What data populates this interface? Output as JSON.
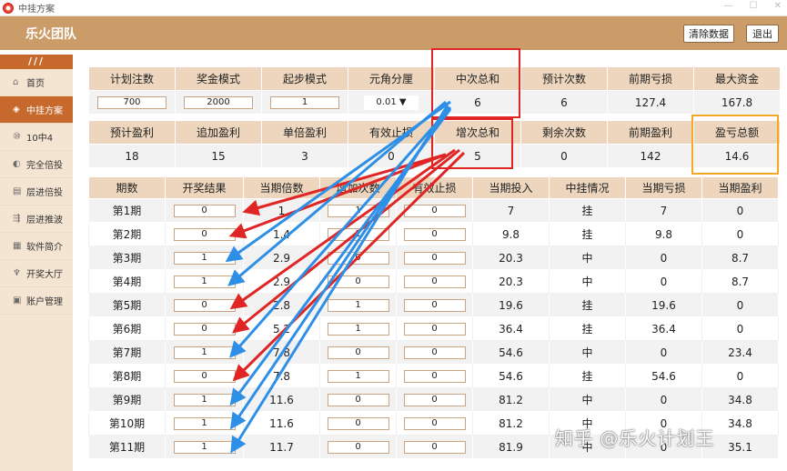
{
  "window": {
    "title": "中挂方案"
  },
  "header": {
    "brand": "乐火团队",
    "clear_label": "清除数据",
    "exit_label": "退出"
  },
  "sidebar": {
    "top": "///",
    "items": [
      {
        "icon": "home-icon",
        "label": "首页"
      },
      {
        "icon": "plan-icon",
        "label": "中挂方案"
      },
      {
        "icon": "ten-icon",
        "label": "10中4"
      },
      {
        "icon": "double-icon",
        "label": "完全倍投"
      },
      {
        "icon": "layer-icon",
        "label": "层进倍投"
      },
      {
        "icon": "push-icon",
        "label": "层进推波"
      },
      {
        "icon": "software-icon",
        "label": "软件简介"
      },
      {
        "icon": "draw-icon",
        "label": "开奖大厅"
      },
      {
        "icon": "account-icon",
        "label": "账户管理"
      }
    ],
    "active_index": 1
  },
  "settings": {
    "row1_headers": [
      "计划注数",
      "奖金模式",
      "起步模式",
      "元角分厘",
      "中次总和",
      "预计次数",
      "前期亏损",
      "最大资金"
    ],
    "row1_values": {
      "plan_bets": "700",
      "bonus_mode": "2000",
      "start_mode": "1",
      "unit": "0.01 ▼",
      "hit_total": "6",
      "expected_times": "6",
      "prior_loss": "127.4",
      "max_funds": "167.8"
    },
    "row2_headers": [
      "预计盈利",
      "追加盈利",
      "单倍盈利",
      "有效止损",
      "增次总和",
      "剩余次数",
      "前期盈利",
      "盈亏总额"
    ],
    "row2_values": [
      "18",
      "15",
      "3",
      "0",
      "5",
      "0",
      "142",
      "14.6"
    ]
  },
  "table": {
    "headers": [
      "期数",
      "开奖结果",
      "当期倍数",
      "增加次数",
      "有效止损",
      "当期投入",
      "中挂情况",
      "当期亏损",
      "当期盈利"
    ],
    "rows": [
      {
        "period": "第1期",
        "result": "0",
        "mult": "1",
        "add": "1",
        "stop": "0",
        "invest": "7",
        "status": "挂",
        "loss": "7",
        "profit": "0"
      },
      {
        "period": "第2期",
        "result": "0",
        "mult": "1.4",
        "add": "1",
        "stop": "0",
        "invest": "9.8",
        "status": "挂",
        "loss": "9.8",
        "profit": "0"
      },
      {
        "period": "第3期",
        "result": "1",
        "mult": "2.9",
        "add": "0",
        "stop": "0",
        "invest": "20.3",
        "status": "中",
        "loss": "0",
        "profit": "8.7"
      },
      {
        "period": "第4期",
        "result": "1",
        "mult": "2.9",
        "add": "0",
        "stop": "0",
        "invest": "20.3",
        "status": "中",
        "loss": "0",
        "profit": "8.7"
      },
      {
        "period": "第5期",
        "result": "0",
        "mult": "2.8",
        "add": "1",
        "stop": "0",
        "invest": "19.6",
        "status": "挂",
        "loss": "19.6",
        "profit": "0"
      },
      {
        "period": "第6期",
        "result": "0",
        "mult": "5.2",
        "add": "1",
        "stop": "0",
        "invest": "36.4",
        "status": "挂",
        "loss": "36.4",
        "profit": "0"
      },
      {
        "period": "第7期",
        "result": "1",
        "mult": "7.8",
        "add": "0",
        "stop": "0",
        "invest": "54.6",
        "status": "中",
        "loss": "0",
        "profit": "23.4"
      },
      {
        "period": "第8期",
        "result": "0",
        "mult": "7.8",
        "add": "1",
        "stop": "0",
        "invest": "54.6",
        "status": "挂",
        "loss": "54.6",
        "profit": "0"
      },
      {
        "period": "第9期",
        "result": "1",
        "mult": "11.6",
        "add": "0",
        "stop": "0",
        "invest": "81.2",
        "status": "中",
        "loss": "0",
        "profit": "34.8"
      },
      {
        "period": "第10期",
        "result": "1",
        "mult": "11.6",
        "add": "0",
        "stop": "0",
        "invest": "81.2",
        "status": "中",
        "loss": "0",
        "profit": "34.8"
      },
      {
        "period": "第11期",
        "result": "1",
        "mult": "11.7",
        "add": "0",
        "stop": "0",
        "invest": "81.9",
        "status": "中",
        "loss": "0",
        "profit": "35.1"
      }
    ]
  },
  "watermark": "知乎 @乐火计划王",
  "colors": {
    "header": "#cc9c68",
    "sidebar_active": "#c7692c",
    "cell_header": "#edd6bd",
    "red_arrow": "#e02525",
    "blue_arrow": "#2e8fe6",
    "highlight_orange": "#f5a623"
  }
}
